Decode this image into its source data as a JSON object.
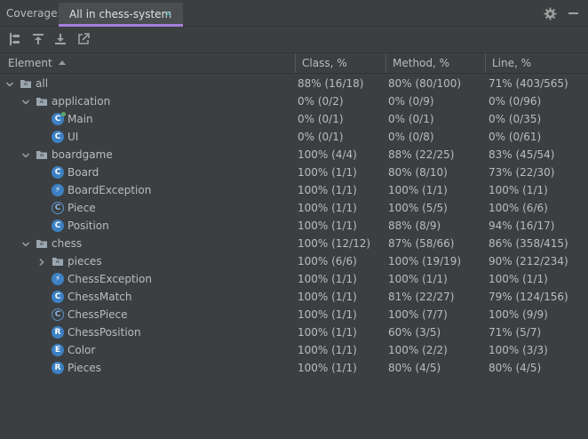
{
  "window": {
    "label": "Coverage:",
    "tab_label": "All in chess-system",
    "tab_close": "×"
  },
  "header": {
    "element": "Element",
    "class_pct": "Class, %",
    "method_pct": "Method, %",
    "line_pct": "Line, %"
  },
  "rows": [
    {
      "name": "all",
      "depth": 0,
      "type": "folder",
      "expanded": true,
      "cls": "88% (16/18)",
      "method": "80% (80/100)",
      "line": "71% (403/565)"
    },
    {
      "name": "application",
      "depth": 1,
      "type": "folder",
      "expanded": true,
      "cls": "0% (0/2)",
      "method": "0% (0/9)",
      "line": "0% (0/96)"
    },
    {
      "name": "Main",
      "depth": 2,
      "type": "class-main",
      "cls": "0% (0/1)",
      "method": "0% (0/1)",
      "line": "0% (0/35)"
    },
    {
      "name": "UI",
      "depth": 2,
      "type": "class",
      "cls": "0% (0/1)",
      "method": "0% (0/8)",
      "line": "0% (0/61)"
    },
    {
      "name": "boardgame",
      "depth": 1,
      "type": "folder",
      "expanded": true,
      "cls": "100% (4/4)",
      "method": "88% (22/25)",
      "line": "83% (45/54)"
    },
    {
      "name": "Board",
      "depth": 2,
      "type": "class",
      "cls": "100% (1/1)",
      "method": "80% (8/10)",
      "line": "73% (22/30)"
    },
    {
      "name": "BoardException",
      "depth": 2,
      "type": "exception",
      "cls": "100% (1/1)",
      "method": "100% (1/1)",
      "line": "100% (1/1)"
    },
    {
      "name": "Piece",
      "depth": 2,
      "type": "abstract",
      "cls": "100% (1/1)",
      "method": "100% (5/5)",
      "line": "100% (6/6)"
    },
    {
      "name": "Position",
      "depth": 2,
      "type": "class",
      "cls": "100% (1/1)",
      "method": "88% (8/9)",
      "line": "94% (16/17)"
    },
    {
      "name": "chess",
      "depth": 1,
      "type": "folder",
      "expanded": true,
      "cls": "100% (12/12)",
      "method": "87% (58/66)",
      "line": "86% (358/415)"
    },
    {
      "name": "pieces",
      "depth": 2,
      "type": "folder",
      "expanded": false,
      "cls": "100% (6/6)",
      "method": "100% (19/19)",
      "line": "90% (212/234)"
    },
    {
      "name": "ChessException",
      "depth": 2,
      "type": "exception",
      "cls": "100% (1/1)",
      "method": "100% (1/1)",
      "line": "100% (1/1)"
    },
    {
      "name": "ChessMatch",
      "depth": 2,
      "type": "class",
      "cls": "100% (1/1)",
      "method": "81% (22/27)",
      "line": "79% (124/156)"
    },
    {
      "name": "ChessPiece",
      "depth": 2,
      "type": "abstract",
      "cls": "100% (1/1)",
      "method": "100% (7/7)",
      "line": "100% (9/9)"
    },
    {
      "name": "ChessPosition",
      "depth": 2,
      "type": "record",
      "cls": "100% (1/1)",
      "method": "60% (3/5)",
      "line": "71% (5/7)"
    },
    {
      "name": "Color",
      "depth": 2,
      "type": "enum",
      "cls": "100% (1/1)",
      "method": "100% (2/2)",
      "line": "100% (3/3)"
    },
    {
      "name": "Pieces",
      "depth": 2,
      "type": "record",
      "cls": "100% (1/1)",
      "method": "80% (4/5)",
      "line": "80% (4/5)"
    }
  ],
  "icons": {
    "class": "C",
    "class-main": "C",
    "exception": "⚡",
    "abstract": "C",
    "record": "R",
    "enum": "E"
  },
  "colors": {
    "accent": "#a37fdc",
    "class_icon": "#3d81c4",
    "folder": "#9aa7b0",
    "background": "#3c3f41"
  }
}
